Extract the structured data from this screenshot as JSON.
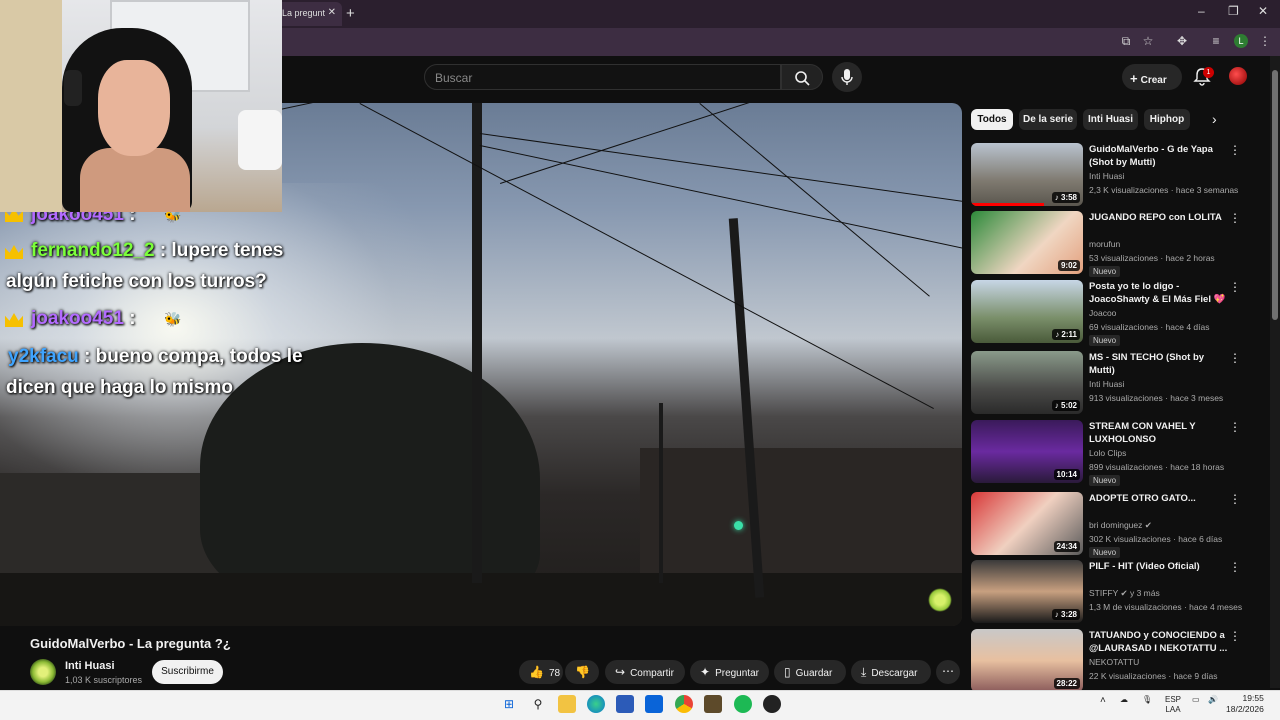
{
  "browser": {
    "tab_title": "La pregunt",
    "new_tab": "+",
    "window_controls": [
      "–",
      "❐",
      "✕"
    ],
    "profile_initial": "L"
  },
  "masthead": {
    "search_placeholder": "Buscar",
    "create_label": "Crear",
    "notifications_count": "1"
  },
  "chat": [
    {
      "user": "joakoo451",
      "text": ":",
      "badge": "crown",
      "emote": "bee"
    },
    {
      "user": "fernando12_2",
      "text": ": lupere tenes",
      "badge": "crown"
    },
    {
      "continuation": "algún fetiche con los turros?"
    },
    {
      "user": "joakoo451",
      "text": ":",
      "badge": "crown",
      "emote": "bee"
    },
    {
      "user": "y2kfacu",
      "text": ": bueno compa, todos le"
    },
    {
      "continuation": "dicen que haga lo mismo"
    }
  ],
  "video": {
    "title": "GuidoMalVerbo - La pregunta ?¿",
    "channel": "Inti Huasi",
    "subscribers": "1,03 K suscriptores",
    "subscribe_label": "Suscribirme",
    "likes": "78",
    "actions": {
      "share": "Compartir",
      "ask": "Preguntar",
      "save": "Guardar",
      "download": "Descargar"
    }
  },
  "sidebar": {
    "chips": [
      "Todos",
      "De la serie",
      "Inti Huasi",
      "Hiphop"
    ],
    "recommendations": [
      {
        "title": "GuidoMalVerbo - G de Yapa (Shot by Mutti)",
        "channel": "Inti Huasi",
        "meta": "2,3 K visualizaciones · hace 3 semanas",
        "duration": "♪ 3:58",
        "new": "",
        "progress": 0.65
      },
      {
        "title": "JUGANDO REPO con LOLITA",
        "channel": "morufun",
        "meta": "53 visualizaciones · hace 2 horas",
        "duration": "9:02",
        "new": "Nuevo",
        "progress": 0
      },
      {
        "title": "Posta yo te lo digo - JoacoShawty & El Más Fiel 💖 ...",
        "channel": "Joacoo",
        "meta": "69 visualizaciones · hace 4 días",
        "duration": "♪ 2:11",
        "new": "Nuevo",
        "progress": 0
      },
      {
        "title": "MS - SIN TECHO (Shot by Mutti)",
        "channel": "Inti Huasi",
        "meta": "913 visualizaciones · hace 3 meses",
        "duration": "♪ 5:02",
        "new": "",
        "progress": 0
      },
      {
        "title": "STREAM CON VAHEL Y LUXHOLONSO",
        "channel": "Lolo Clips",
        "meta": "899 visualizaciones · hace 18 horas",
        "duration": "10:14",
        "new": "Nuevo",
        "progress": 0
      },
      {
        "title": "ADOPTE OTRO GATO...",
        "channel": "bri dominguez ✔",
        "meta": "302 K visualizaciones · hace 6 días",
        "duration": "24:34",
        "new": "Nuevo",
        "progress": 0
      },
      {
        "title": "PILF - HIT (Video Oficial)",
        "channel": "STIFFY ✔ y 3 más",
        "meta": "1,3 M de visualizaciones · hace 4 meses",
        "duration": "♪ 3:28",
        "new": "",
        "progress": 0
      },
      {
        "title": "TATUANDO y CONOCIENDO a @LAURASAD I NEKOTATTU ...",
        "channel": "NEKOTATTU",
        "meta": "22 K visualizaciones · hace 9 días",
        "duration": "28:22",
        "new": "",
        "progress": 0
      }
    ]
  },
  "taskbar": {
    "lang": "ESP",
    "lang_sub": "LAA",
    "time": "19:55",
    "date": "18/2/2026"
  }
}
